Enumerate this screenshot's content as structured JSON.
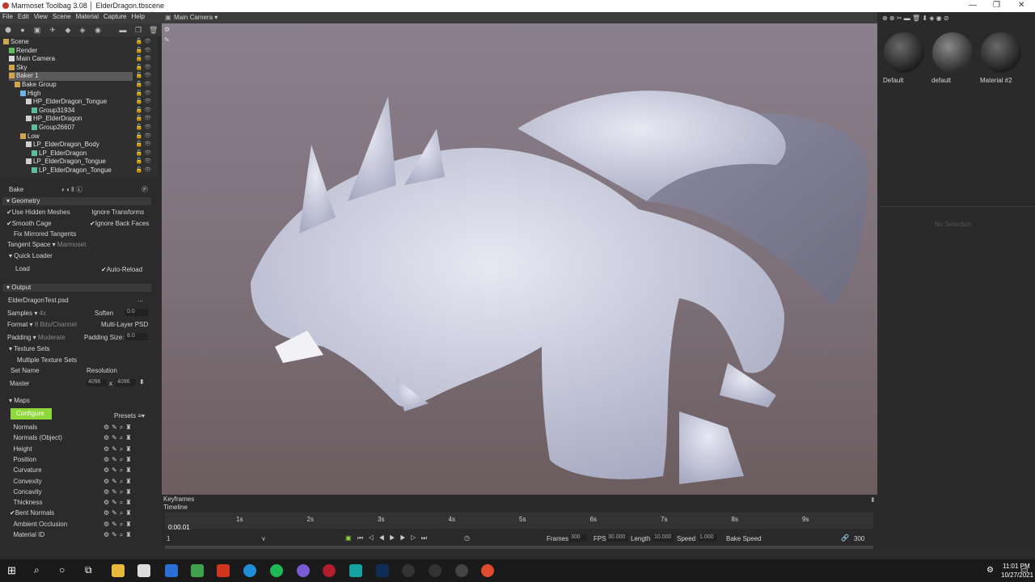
{
  "title": "Marmoset Toolbag 3.08 │ ElderDragon.tbscene",
  "menu": [
    "File",
    "Edit",
    "View",
    "Scene",
    "Material",
    "Capture",
    "Help"
  ],
  "viewport": {
    "camera": "Main Camera ▾"
  },
  "scene_tree": [
    {
      "label": "Scene",
      "indent": 0
    },
    {
      "label": "Render",
      "indent": 1
    },
    {
      "label": "Main Camera",
      "indent": 1
    },
    {
      "label": "Sky",
      "indent": 1
    },
    {
      "label": "Baker 1",
      "indent": 1,
      "selected": true
    },
    {
      "label": "Bake Group",
      "indent": 2
    },
    {
      "label": "High",
      "indent": 3
    },
    {
      "label": "HP_ElderDragon_Tongue",
      "indent": 4
    },
    {
      "label": "Group31934",
      "indent": 5
    },
    {
      "label": "HP_ElderDragon",
      "indent": 4
    },
    {
      "label": "Group26607",
      "indent": 5
    },
    {
      "label": "Low",
      "indent": 3
    },
    {
      "label": "LP_ElderDragon_Body",
      "indent": 4
    },
    {
      "label": "LP_ElderDragon",
      "indent": 5
    },
    {
      "label": "LP_ElderDragon_Tongue",
      "indent": 4
    },
    {
      "label": "LP_ElderDragon_Tongue",
      "indent": 5
    }
  ],
  "panel": {
    "bake": "Bake",
    "geometry": "Geometry",
    "use_hidden": "Use Hidden Meshes",
    "ignore_transforms": "Ignore Transforms",
    "smooth_cage": "Smooth Cage",
    "ignore_back": "Ignore Back Faces",
    "fix_mirrored": "Fix Mirrored Tangents",
    "tangent_space": "Tangent Space ▾",
    "tangent_value": "Marmoset",
    "quick_loader": "Quick Loader",
    "load": "Load",
    "auto_reload": "Auto-Reload",
    "output": "Output",
    "file": "ElderDragonTest.psd",
    "file_btn": "...",
    "samples": "Samples ▾",
    "samples_val": "4x",
    "soften": "Soften",
    "soften_val": "0.0",
    "format": "Format ▾",
    "format_val": "8 Bits/Channel",
    "multilayer": "Multi-Layer PSD",
    "padding": "Padding ▾",
    "padding_val": "Moderate",
    "padding_size": "Padding Size:",
    "padding_size_val": "8.0",
    "texture_sets": "Texture Sets",
    "multiple_sets": "Multiple Texture Sets",
    "set_name": "Set Name",
    "resolution": "Resolution",
    "master": "Master",
    "res_w": "4096",
    "res_x": "x",
    "res_h": "4096",
    "maps": "Maps",
    "configure": "Configure",
    "presets": "Presets ≡▾",
    "map_list": [
      "Normals",
      "Normals (Object)",
      "Height",
      "Position",
      "Curvature",
      "Convexity",
      "Concavity",
      "Thickness",
      "Bent Normals",
      "Ambient Occlusion",
      "Material ID"
    ],
    "map_checked": [
      false,
      false,
      false,
      false,
      false,
      false,
      false,
      false,
      true,
      false,
      false
    ]
  },
  "materials": [
    "Default",
    "default",
    "Material #2"
  ],
  "no_selection": "No Selection",
  "timeline": {
    "keyframes": "Keyframes",
    "timeline": "Timeline",
    "time": "0:00.01",
    "ticks": [
      "1s",
      "2s",
      "3s",
      "4s",
      "5s",
      "6s",
      "7s",
      "8s",
      "9s"
    ],
    "frame": "1",
    "frames_label": "Frames",
    "frames": "300",
    "fps_label": "FPS",
    "fps": "30.000",
    "length_label": "Length",
    "length": "10.000",
    "speed_label": "Speed",
    "speed": "1.000",
    "bake_speed": "Bake Speed",
    "end": "300"
  },
  "taskbar": {
    "time": "11:01 PM",
    "date": "10/27/2021"
  }
}
